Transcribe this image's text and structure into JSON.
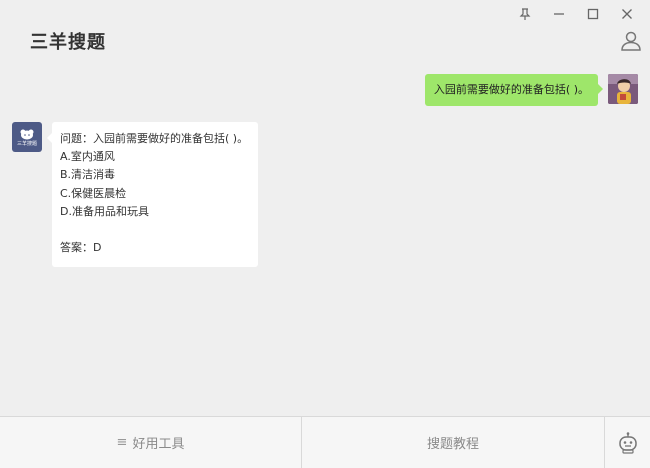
{
  "app": {
    "title": "三羊搜题"
  },
  "icons": {
    "pin": "pin-icon",
    "minimize": "minimize-icon",
    "maximize": "maximize-icon",
    "close": "close-icon",
    "user": "user-icon",
    "menu": "menu-icon",
    "robot": "robot-icon"
  },
  "chat": {
    "outgoing": {
      "text": "入园前需要做好的准备包括( )。"
    },
    "incoming": {
      "avatar_label": "三羊搜题",
      "question": "问题：入园前需要做好的准备包括( )。",
      "options": [
        "A.室内通风",
        "B.清洁消毒",
        "C.保健医晨检",
        "D.准备用品和玩具"
      ],
      "answer": "答案：D"
    }
  },
  "toolbar": {
    "tools_label": "好用工具",
    "tutorial_label": "搜题教程"
  },
  "colors": {
    "background": "#efefef",
    "outgoing_bubble": "#9ee66a",
    "incoming_bubble": "#ffffff",
    "bot_avatar": "#4d5a86"
  }
}
